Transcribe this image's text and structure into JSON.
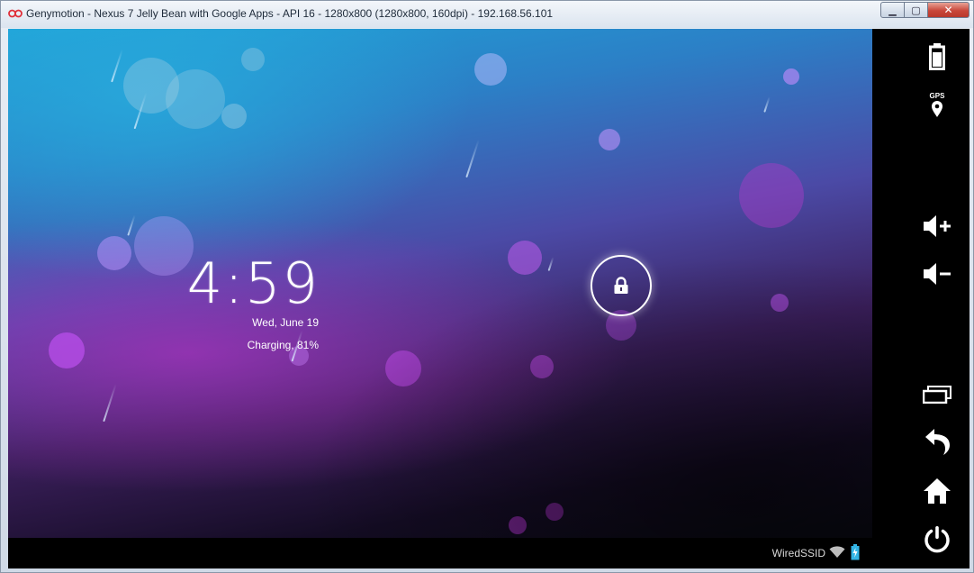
{
  "window": {
    "title": "Genymotion - Nexus 7 Jelly Bean with Google Apps - API 16 - 1280x800 (1280x800, 160dpi) - 192.168.56.101",
    "controls": {
      "minimize": "▁",
      "maximize": "▢",
      "close": "✕"
    }
  },
  "lockscreen": {
    "time": "4:59",
    "date": "Wed, June 19",
    "charging": "Charging, 81%"
  },
  "statusbar": {
    "network_name": "WiredSSID"
  },
  "sidebar": {
    "gps_label": "GPS"
  },
  "colors": {
    "accent_blue": "#1ea4d8",
    "accent_purple": "#8a3cc8",
    "close_red": "#c9473a",
    "battery_cyan": "#33b5e5"
  }
}
